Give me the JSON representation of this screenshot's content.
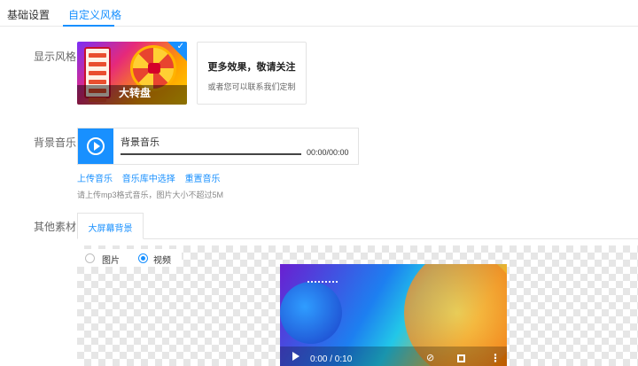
{
  "tabs": {
    "basic": "基础设置",
    "custom": "自定义风格"
  },
  "display_style": {
    "label": "显示风格",
    "selected_card": {
      "caption": "大转盘",
      "check_icon": "check-icon"
    },
    "more_card": {
      "title": "更多效果，敬请关注",
      "subtitle": "或者您可以联系我们定制"
    }
  },
  "background_music": {
    "label": "背景音乐",
    "player": {
      "title": "背景音乐",
      "time": "00:00/00:00",
      "play_icon": "play-circle-icon"
    },
    "links": {
      "upload": "上传音乐",
      "library": "音乐库中选择",
      "reset": "重置音乐"
    },
    "hint": "请上传mp3格式音乐，图片大小不超过5M"
  },
  "other_material": {
    "label": "其他素材",
    "tab": "大屏幕背景",
    "radio": {
      "image": "图片",
      "video": "视频",
      "selected": "视频"
    },
    "video": {
      "time": "0:00 / 0:10",
      "mute_icon": "mute-icon",
      "fullscreen_icon": "fullscreen-icon",
      "more_icon": "more-vertical-icon"
    }
  },
  "colors": {
    "accent": "#1890ff"
  }
}
